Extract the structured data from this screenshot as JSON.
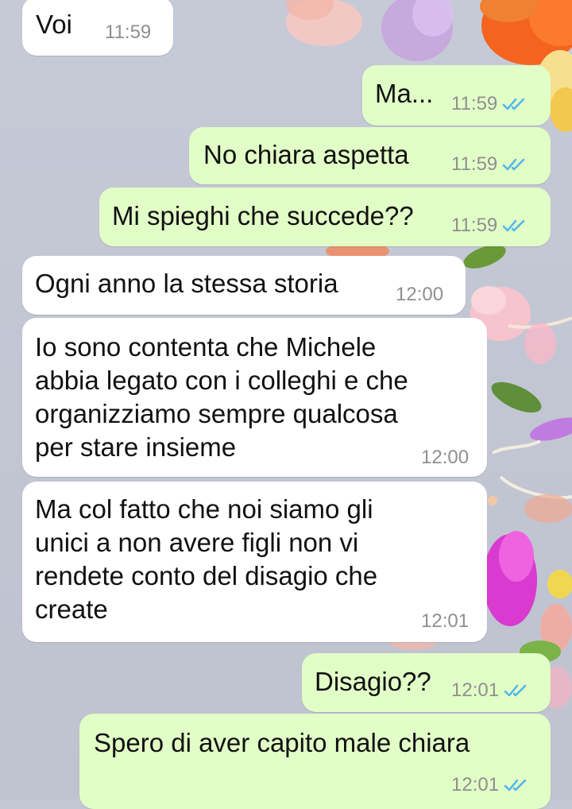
{
  "colors": {
    "incoming_bubble": "#ffffff",
    "outgoing_bubble": "#e2fec7",
    "text": "#111111",
    "time": "#8f8f8f",
    "read_ticks": "#4fb6ec",
    "wallpaper": "#c4c8d5"
  },
  "icons": {
    "read_receipt": "double-check-icon"
  },
  "messages": [
    {
      "direction": "incoming",
      "text": "Voi",
      "time": "11:59"
    },
    {
      "direction": "outgoing",
      "text": "Ma...",
      "time": "11:59",
      "status": "read"
    },
    {
      "direction": "outgoing",
      "text": "No chiara aspetta",
      "time": "11:59",
      "status": "read"
    },
    {
      "direction": "outgoing",
      "text": "Mi spieghi che succede??",
      "time": "11:59",
      "status": "read"
    },
    {
      "direction": "incoming",
      "text": "Ogni anno la stessa storia",
      "time": "12:00"
    },
    {
      "direction": "incoming",
      "text": "Io sono contenta che Michele\nabbia legato con i colleghi e che\norganizziamo sempre qualcosa\nper stare insieme",
      "time": "12:00"
    },
    {
      "direction": "incoming",
      "text": "Ma col fatto che noi siamo gli\nunici a non avere figli non vi\nrendete conto del disagio che\ncreate",
      "time": "12:01"
    },
    {
      "direction": "outgoing",
      "text": "Disagio??",
      "time": "12:01",
      "status": "read"
    },
    {
      "direction": "outgoing",
      "text": "Spero di aver capito male chiara",
      "time": "12:01",
      "status": "read"
    }
  ]
}
